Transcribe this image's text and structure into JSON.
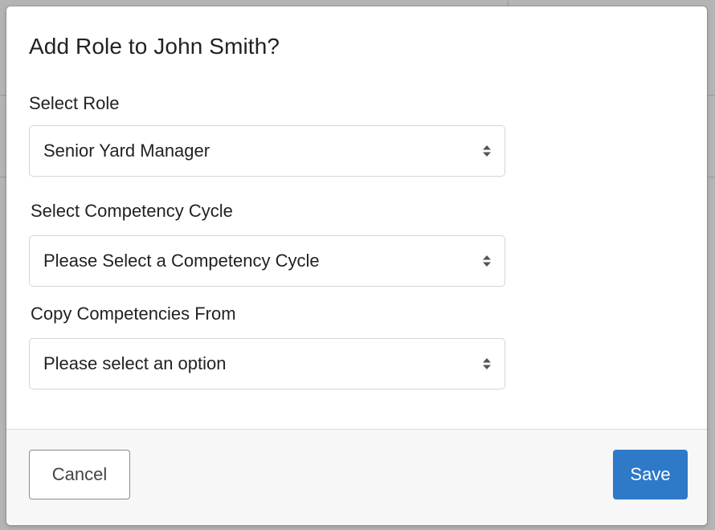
{
  "dialog": {
    "title": "Add Role to John Smith?"
  },
  "fields": {
    "role": {
      "label": "Select Role",
      "value": "Senior Yard Manager"
    },
    "cycle": {
      "label": "Select Competency Cycle",
      "value": "Please Select a Competency Cycle"
    },
    "copy_from": {
      "label": "Copy Competencies From",
      "value": "Please select an option"
    }
  },
  "footer": {
    "cancel_label": "Cancel",
    "save_label": "Save"
  },
  "icons": {
    "select_caret": "sort-caret-icon"
  },
  "colors": {
    "primary": "#2f79c9",
    "text": "#222222",
    "overlay": "#b4b4b4"
  }
}
